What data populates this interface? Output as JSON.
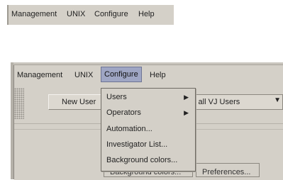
{
  "top_menu": [
    "Management",
    "UNIX",
    "Configure",
    "Help"
  ],
  "menubar": {
    "items": [
      "Management",
      "UNIX",
      "Configure",
      "Help"
    ],
    "active": "Configure"
  },
  "toolbar": {
    "new_user_label": "New User",
    "user_filter_value": "v all VJ Users"
  },
  "configure_menu": {
    "items": [
      {
        "label": "Users",
        "submenu": true
      },
      {
        "label": "Operators",
        "submenu": true
      },
      {
        "label": "Automation...",
        "submenu": false
      },
      {
        "label": "Investigator List...",
        "submenu": false
      },
      {
        "label": "Background colors...",
        "submenu": false
      }
    ]
  },
  "buttons": {
    "background_colors_label": "Background colors...",
    "preferences_label": "Preferences..."
  },
  "colors": {
    "menu_bg": "#d4d0c8",
    "active_menu_bg": "#9fa6c4"
  },
  "icons": {
    "submenu_arrow": "▶",
    "combo_arrow": "▼"
  }
}
